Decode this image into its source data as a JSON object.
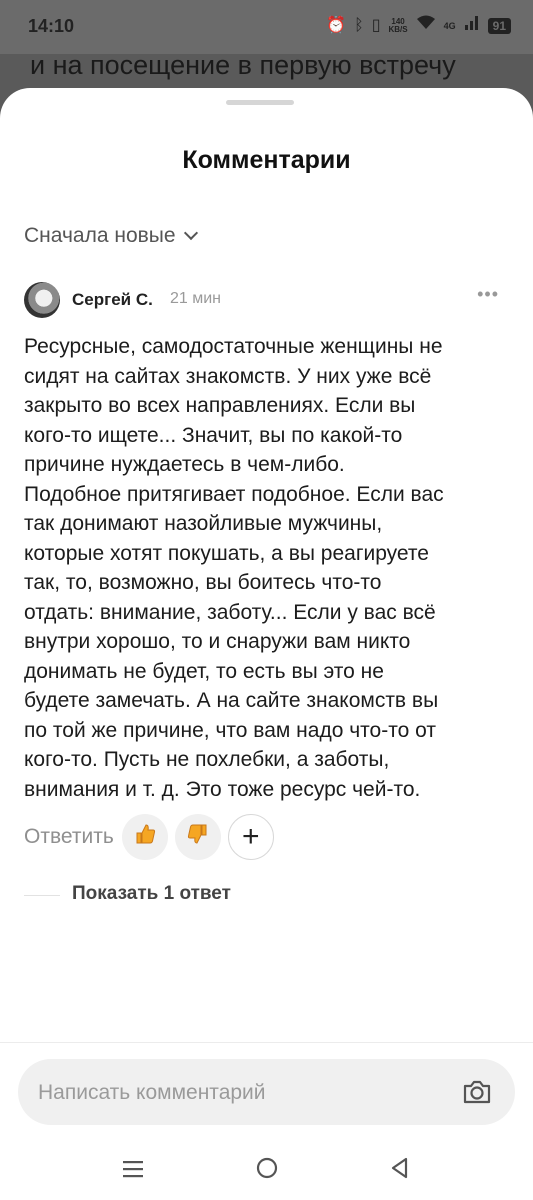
{
  "status_bar": {
    "time": "14:10",
    "net_speed_value": "140",
    "net_speed_unit": "KB/S",
    "signal_label": "4G",
    "battery": "91"
  },
  "background": {
    "text": "и на посещение в первую встречу"
  },
  "sheet": {
    "title": "Комментарии",
    "sort_label": "Сначала новые"
  },
  "comment": {
    "author": "Сергей С.",
    "time": "21 мин",
    "lines": [
      "Ресурсные, самодостаточные женщины не",
      "сидят на сайтах знакомств. У них уже всё",
      "закрыто во всех направлениях. Если вы",
      "кого-то ищете... Значит, вы по какой-то",
      "причине нуждаетесь в чем-либо.",
      "Подобное притягивает подобное. Если вас",
      "так донимают назойливые мужчины,",
      "которые хотят покушать, а вы реагируете",
      "так, то, возможно, вы боитесь что-то",
      "отдать: внимание, заботу... Если у вас всё",
      "внутри хорошо, то и снаружи вам никто",
      "донимать не будет, то есть вы это не",
      "будете замечать. А на сайте знакомств вы",
      "по той же причине, что вам надо что-то от",
      "кого-то. Пусть не похлебки, а заботы,",
      "внимания и т. д. Это тоже ресурс чей-то."
    ],
    "reply_label": "Ответить",
    "like_icon": "thumbs-up-icon",
    "dislike_icon": "thumbs-down-icon",
    "add_reaction_icon": "plus-icon",
    "show_replies_label": "Показать 1 ответ"
  },
  "composer": {
    "placeholder": "Написать комментарий",
    "camera_icon": "camera-icon"
  },
  "colors": {
    "accent_reaction": "#f5a623",
    "text_primary": "#1c1c1c",
    "text_secondary": "#8f8f8f"
  }
}
